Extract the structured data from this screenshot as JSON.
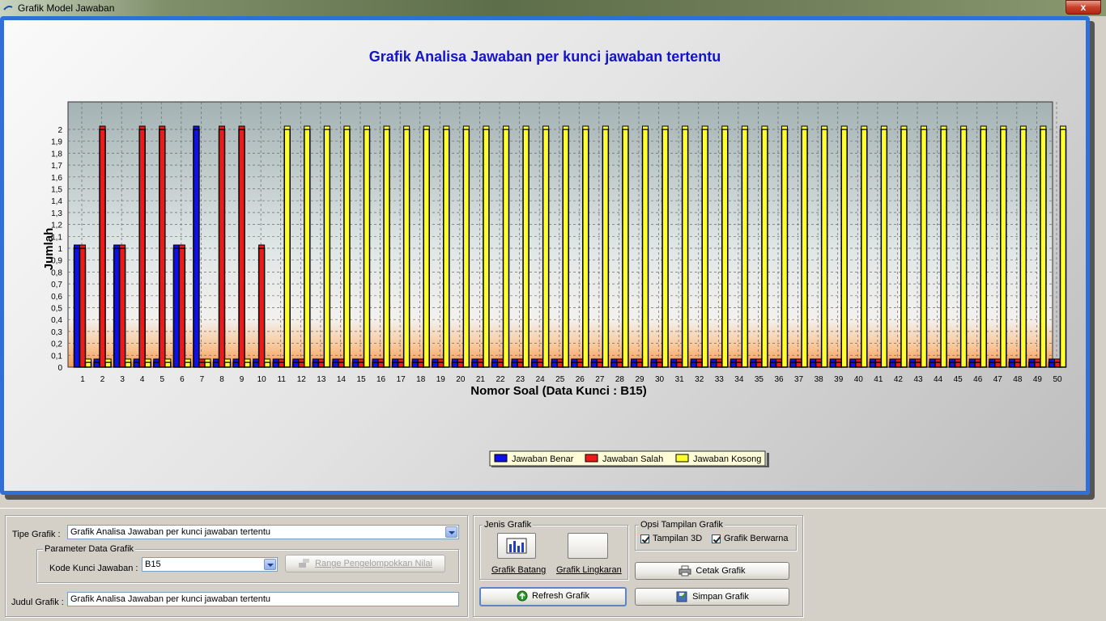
{
  "window": {
    "title": "Grafik Model Jawaban",
    "close_label": "x"
  },
  "colors": {
    "benar": "#1010e8",
    "salah": "#ee1a1a",
    "kosong": "#ffff30",
    "frame": "#2f6fd8",
    "title": "#1414c8"
  },
  "chart_data": {
    "type": "bar",
    "title": "Grafik Analisa Jawaban per kunci jawaban tertentu",
    "xlabel": "Nomor Soal (Data Kunci : B15)",
    "ylabel": "Jumlah",
    "ylim": [
      0,
      2
    ],
    "y_ticks": [
      "0",
      "0,1",
      "0,2",
      "0,3",
      "0,4",
      "0,5",
      "0,6",
      "0,7",
      "0,8",
      "0,9",
      "1",
      "1,1",
      "1,2",
      "1,3",
      "1,4",
      "1,5",
      "1,6",
      "1,7",
      "1,8",
      "1,9",
      "2"
    ],
    "categories": [
      "1",
      "2",
      "3",
      "4",
      "5",
      "6",
      "7",
      "8",
      "9",
      "10",
      "11",
      "12",
      "13",
      "14",
      "15",
      "16",
      "17",
      "18",
      "19",
      "20",
      "21",
      "22",
      "23",
      "24",
      "25",
      "26",
      "27",
      "28",
      "29",
      "30",
      "31",
      "32",
      "33",
      "34",
      "35",
      "36",
      "37",
      "38",
      "39",
      "40",
      "41",
      "42",
      "43",
      "44",
      "45",
      "46",
      "47",
      "48",
      "49",
      "50"
    ],
    "series": [
      {
        "name": "Jawaban Benar",
        "color": "#1010e8",
        "values": [
          1,
          0,
          1,
          0,
          0,
          1,
          2,
          0,
          0,
          0,
          0,
          0,
          0,
          0,
          0,
          0,
          0,
          0,
          0,
          0,
          0,
          0,
          0,
          0,
          0,
          0,
          0,
          0,
          0,
          0,
          0,
          0,
          0,
          0,
          0,
          0,
          0,
          0,
          0,
          0,
          0,
          0,
          0,
          0,
          0,
          0,
          0,
          0,
          0,
          0
        ]
      },
      {
        "name": "Jawaban Salah",
        "color": "#ee1a1a",
        "values": [
          1,
          2,
          1,
          2,
          2,
          1,
          0,
          2,
          2,
          1,
          0,
          0,
          0,
          0,
          0,
          0,
          0,
          0,
          0,
          0,
          0,
          0,
          0,
          0,
          0,
          0,
          0,
          0,
          0,
          0,
          0,
          0,
          0,
          0,
          0,
          0,
          0,
          0,
          0,
          0,
          0,
          0,
          0,
          0,
          0,
          0,
          0,
          0,
          0,
          0
        ]
      },
      {
        "name": "Jawaban Kosong",
        "color": "#ffff30",
        "values": [
          0,
          0,
          0,
          0,
          0,
          0,
          0,
          0,
          0,
          0,
          2,
          2,
          2,
          2,
          2,
          2,
          2,
          2,
          2,
          2,
          2,
          2,
          2,
          2,
          2,
          2,
          2,
          2,
          2,
          2,
          2,
          2,
          2,
          2,
          2,
          2,
          2,
          2,
          2,
          2,
          2,
          2,
          2,
          2,
          2,
          2,
          2,
          2,
          2,
          2
        ]
      }
    ],
    "grid": true,
    "legend_position": "bottom-center",
    "three_d": true
  },
  "controls": {
    "tipe_label": "Tipe Grafik :",
    "tipe_value": "Grafik Analisa Jawaban per kunci jawaban tertentu",
    "parameter_title": "Parameter Data Grafik",
    "kode_label": "Kode Kunci Jawaban :",
    "kode_value": "B15",
    "range_button": "Range Pengelompokkan Nilai",
    "judul_label": "Judul Grafik :",
    "judul_value": "Grafik Analisa Jawaban per kunci jawaban tertentu",
    "jenis_title": "Jenis Grafik",
    "batang_label": "Grafik Batang",
    "lingkaran_label": "Grafik Lingkaran",
    "refresh_button": "Refresh Grafik",
    "opsi_title": "Opsi Tampilan Grafik",
    "tampilan3d_label": "Tampilan 3D",
    "berwarna_label": "Grafik Berwarna",
    "cetak_button": "Cetak Grafik",
    "simpan_button": "Simpan Grafik"
  }
}
